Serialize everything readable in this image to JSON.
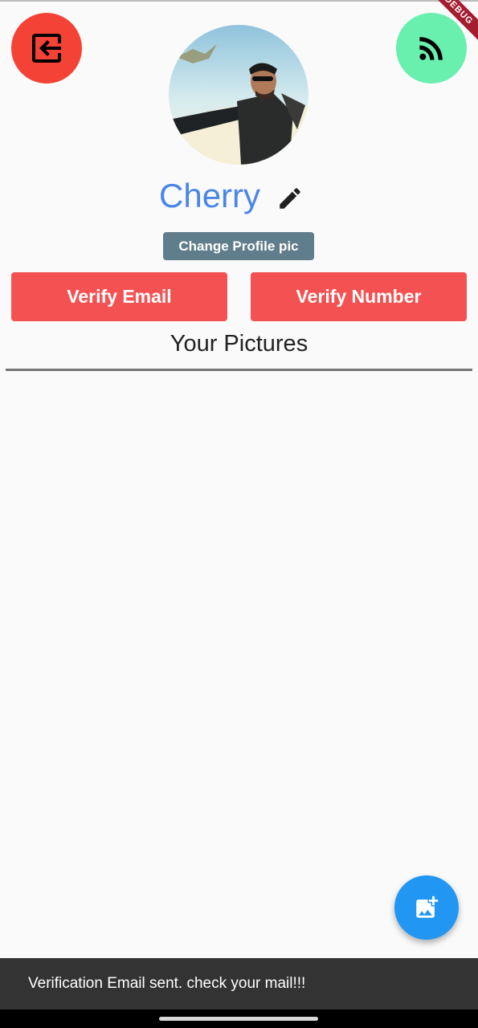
{
  "debug_banner": {
    "label": "DEBUG"
  },
  "header": {
    "logout_icon": "exit-to-app-icon",
    "feed_icon": "rss-feed-icon"
  },
  "profile": {
    "name": "Cherry",
    "edit_icon": "pencil-icon",
    "change_pic_label": "Change Profile pic"
  },
  "actions": {
    "verify_email_label": "Verify Email",
    "verify_number_label": "Verify Number"
  },
  "section": {
    "title": "Your Pictures"
  },
  "fab": {
    "icon": "add-photo-icon"
  },
  "snackbar": {
    "message": "Verification Email sent. check your mail!!!"
  },
  "colors": {
    "logout_button": "#f44336",
    "feed_button": "#69f0ae",
    "username": "#4a86e8",
    "change_pic_button": "#607d8b",
    "verify_buttons": "#f45252",
    "fab": "#2196f3",
    "snackbar": "#333333"
  }
}
